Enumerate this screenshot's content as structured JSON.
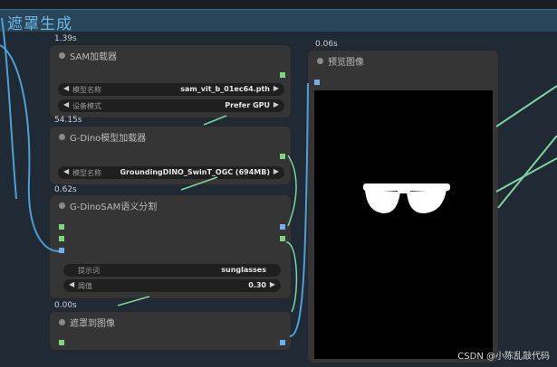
{
  "group": {
    "title": "遮罩生成"
  },
  "nodes": {
    "sam_loader": {
      "time": "1.39s",
      "title": "SAM加载器",
      "widgets": [
        {
          "label": "模型名称",
          "value": "sam_vit_b_01ec64.pth"
        },
        {
          "label": "设备模式",
          "value": "Prefer GPU"
        }
      ]
    },
    "gdino_loader": {
      "time": "54.15s",
      "title": "G-Dino模型加载器",
      "widgets": [
        {
          "label": "模型名称",
          "value": "GroundingDINO_SwinT_OGC (694MB)"
        }
      ]
    },
    "gdino_sam": {
      "time": "0.62s",
      "title": "G-DinoSAM语义分割",
      "widgets": [
        {
          "label": "提示词",
          "value": "sunglasses"
        },
        {
          "label": "阈值",
          "value": "0.30"
        }
      ]
    },
    "mask_to_image": {
      "time": "0.00s",
      "title": "遮罩到图像"
    },
    "preview": {
      "time": "0.06s",
      "title": "预览图像"
    }
  },
  "colors": {
    "group_header": "#27465a",
    "wire_blue": "#4f9fd6",
    "wire_green": "#7fd3a0",
    "port_green": "#7ed67e",
    "port_blue": "#6fb0e8"
  },
  "watermark": "CSDN @小陈乱敲代码"
}
